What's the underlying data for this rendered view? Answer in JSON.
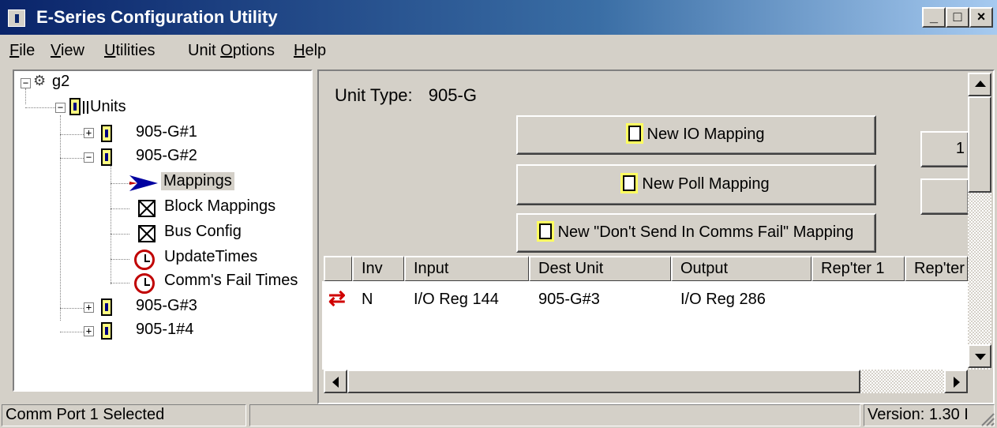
{
  "window": {
    "title": "E-Series Configuration Utility",
    "controls": {
      "minimize": "_",
      "maximize": "□",
      "close": "×"
    }
  },
  "menu": [
    {
      "label": "File",
      "mnemonic": "F",
      "rest": "ile"
    },
    {
      "label": "View",
      "mnemonic": "V",
      "rest": "iew"
    },
    {
      "label": "Utilities",
      "mnemonic": "U",
      "rest": "tilities"
    },
    {
      "label": "Unit Options",
      "pre": "Unit ",
      "mnemonic": "O",
      "rest": "ptions"
    },
    {
      "label": "Help",
      "mnemonic": "H",
      "rest": "elp"
    }
  ],
  "tree": {
    "root": "g2",
    "units_label": "Units",
    "units": [
      "905-G#1",
      "905-G#2",
      "905-G#3",
      "905-1#4"
    ],
    "children": [
      "Mappings",
      "Block Mappings",
      "Bus Config",
      "UpdateTimes",
      "Comm's Fail Times"
    ],
    "selected": "Mappings",
    "expander_collapsed": "+",
    "expander_expanded": "−"
  },
  "panel": {
    "unit_type_label": "Unit Type:",
    "unit_type_value": "905-G",
    "buttons": {
      "new_io": "New IO Mapping",
      "new_poll": "New Poll Mapping",
      "new_dont_send": "New \"Don't Send In Comms Fail\" Mapping"
    },
    "right_btn_glyph": "1"
  },
  "table": {
    "columns": [
      "",
      "Inv",
      "Input",
      "Dest Unit",
      "Output",
      "Rep'ter 1",
      "Rep'ter"
    ],
    "rows": [
      {
        "icon": "⇄",
        "inv": "N",
        "input": "I/O Reg 144",
        "dest": "905-G#3",
        "output": "I/O Reg 286"
      }
    ]
  },
  "status": {
    "left": "Comm Port 1 Selected",
    "middle": "",
    "right": "Version: 1.30 I"
  },
  "colors": {
    "title_start": "#0a246a",
    "title_end": "#a6caf0",
    "selection": "#d4d0c8",
    "swap_icon": "#d00000"
  }
}
